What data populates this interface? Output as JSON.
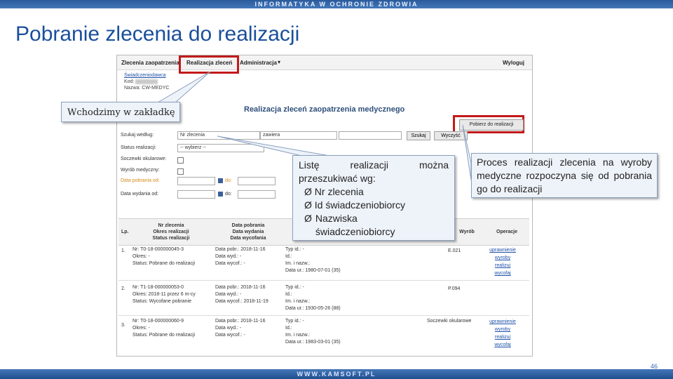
{
  "header": {
    "banner": "INFORMATYKA W OCHRONIE ZDROWIA",
    "title": "Pobranie zlecenia do realizacji"
  },
  "footer": {
    "banner": "WWW.KAMSOFT.PL",
    "page_number": "46"
  },
  "app": {
    "nav": {
      "item1": "Zlecenia zaopatrzenia",
      "item2": "Realizacja zleceń",
      "item3": "Administracja",
      "item3_caret": "▾",
      "logout": "Wyloguj"
    },
    "provider": {
      "name_link": "Świadczeniodawca",
      "code_label": "Kod:",
      "name_label": "Nazwa:",
      "name_value": "CW-MEDYC"
    },
    "page_title": "Realizacja zleceń zaopatrzenia medycznego",
    "pobierz_button": "Pobierz do realizacji",
    "filters": {
      "search_by_label": "Szukaj według:",
      "search_by_value": "Nr zlecenia",
      "status_label": "Status realizacji:",
      "status_value": "-- wybierz --",
      "lenses_label": "Soczewki okularowe:",
      "device_label": "Wyrób medyczny:",
      "date_collect_label": "Data pobrania od:",
      "date_issue_label": "Data wydania od:",
      "do_label": "do:",
      "zawiera_value": "zawiera",
      "szukaj_button": "Szukaj",
      "clear_button": "Wyczyść"
    },
    "table": {
      "headers": {
        "lp": "Lp.",
        "nr": [
          "Nr zlecenia",
          "Okres realizacji",
          "Status realizacji"
        ],
        "dates": [
          "Data pobrania",
          "Data wydania",
          "Data wycofania"
        ],
        "wyrob": "Wyrób",
        "operacje": "Operacje"
      },
      "rows": [
        {
          "lp": "1.",
          "nr": "Nr: T0-18-000000045-3",
          "okres": "Okres: -",
          "status": "Status: Pobrane do realizacji",
          "pobr": "Data pobr.: 2018-11-16",
          "wyd": "Data wyd.: -",
          "wycof": "Data wycof.: -",
          "typ": "Typ id.: -",
          "id": "Id.:",
          "imnaz": "Im. i nazw.:",
          "dur": "Data ur.: 1980-07-01 (35)",
          "wyrob": "E.021",
          "ops": [
            "uprawnienie",
            "wyroby",
            "realizuj",
            "wycofaj"
          ]
        },
        {
          "lp": "2.",
          "nr": "Nr: T1-18-000000053-0",
          "okres": "Okres: 2018-11 przez 6 m-cy",
          "status": "Status: Wycofane pobranie",
          "pobr": "Data pobr.: 2018-11-16",
          "wyd": "Data wyd.: -",
          "wycof": "Data wycof.: 2018-11-19",
          "typ": "Typ id.: -",
          "id": "Id.:",
          "imnaz": "Im. i nazw.:",
          "dur": "Data ur.: 1930-05-26 (88)",
          "wyrob": "P.094",
          "ops": []
        },
        {
          "lp": "3.",
          "nr": "Nr: T0-18-000000060-9",
          "okres": "Okres: -",
          "status": "Status: Pobrane do realizacji",
          "pobr": "Data pobr.: 2018-11-16",
          "wyd": "Data wyd.: -",
          "wycof": "Data wycof.: -",
          "typ": "Typ id.: -",
          "id": "Id.:",
          "imnaz": "Im. i nazw.:",
          "dur": "Data ur.: 1983-03-01 (35)",
          "wyrob": "Soczewki okularowe",
          "ops": [
            "uprawnienie",
            "wyroby",
            "realizuj",
            "wycofaj"
          ]
        }
      ]
    }
  },
  "callouts": {
    "tab": "Wchodzimy w zakładkę",
    "search_intro": "Listę realizacji można przeszukiwać wg:",
    "search_items": [
      "Nr zlecenia",
      "Id świadczeniobiorcy",
      "Nazwiska świadczeniobiorcy"
    ],
    "bullet_symbol": "Ø",
    "process": "Proces realizacji zlecenia na wyroby medyczne rozpoczyna się od pobrania go do realizacji"
  },
  "colors": {
    "accent_blue": "#1a4f9c",
    "highlight_red": "#c21a1a",
    "callout_bg": "#eef3fa"
  }
}
